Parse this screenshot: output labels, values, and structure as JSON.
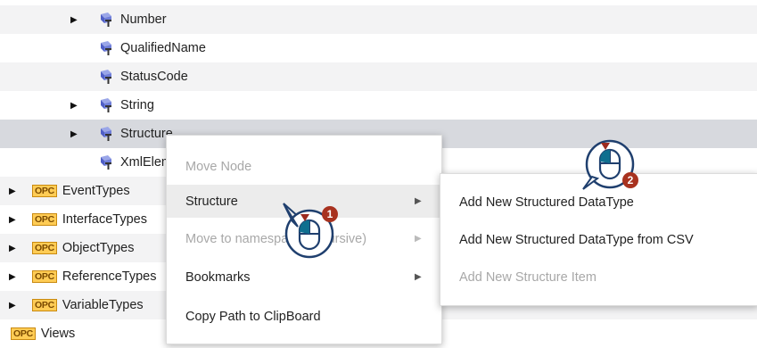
{
  "tree": {
    "rows": [
      {
        "label": "Number",
        "kind": "type",
        "expandable": true
      },
      {
        "label": "QualifiedName",
        "kind": "type",
        "expandable": false
      },
      {
        "label": "StatusCode",
        "kind": "type",
        "expandable": false
      },
      {
        "label": "String",
        "kind": "type",
        "expandable": true
      },
      {
        "label": "Structure",
        "kind": "type",
        "expandable": true,
        "selected": true
      },
      {
        "label": "XmlElement",
        "kind": "type",
        "expandable": false
      },
      {
        "label": "EventTypes",
        "kind": "opc",
        "expandable": true
      },
      {
        "label": "InterfaceTypes",
        "kind": "opc",
        "expandable": true
      },
      {
        "label": "ObjectTypes",
        "kind": "opc",
        "expandable": true
      },
      {
        "label": "ReferenceTypes",
        "kind": "opc",
        "expandable": true
      },
      {
        "label": "VariableTypes",
        "kind": "opc",
        "expandable": true
      },
      {
        "label": "Views",
        "kind": "opc",
        "expandable": false
      }
    ],
    "opc_badge": "OPC"
  },
  "context_menu": {
    "items": [
      {
        "label": "Move Node",
        "disabled": true,
        "submenu": false
      },
      {
        "label": "Structure",
        "disabled": false,
        "submenu": true,
        "highlighted": true
      },
      {
        "label": "Move to namespace (recursive)",
        "disabled": true,
        "submenu": true
      },
      {
        "label": "Bookmarks",
        "disabled": false,
        "submenu": true
      },
      {
        "label": "Copy Path to ClipBoard",
        "disabled": false,
        "submenu": false
      }
    ]
  },
  "submenu": {
    "items": [
      {
        "label": "Add New Structured DataType",
        "disabled": false
      },
      {
        "label": "Add New Structured DataType from CSV",
        "disabled": false
      },
      {
        "label": "Add New Structure Item",
        "disabled": true
      }
    ]
  },
  "cursors": [
    {
      "step": "1"
    },
    {
      "step": "2"
    }
  ],
  "colors": {
    "step_badge": "#a8321f",
    "selected_row": "#d7d9de",
    "opc_badge": "#ffcc55"
  }
}
